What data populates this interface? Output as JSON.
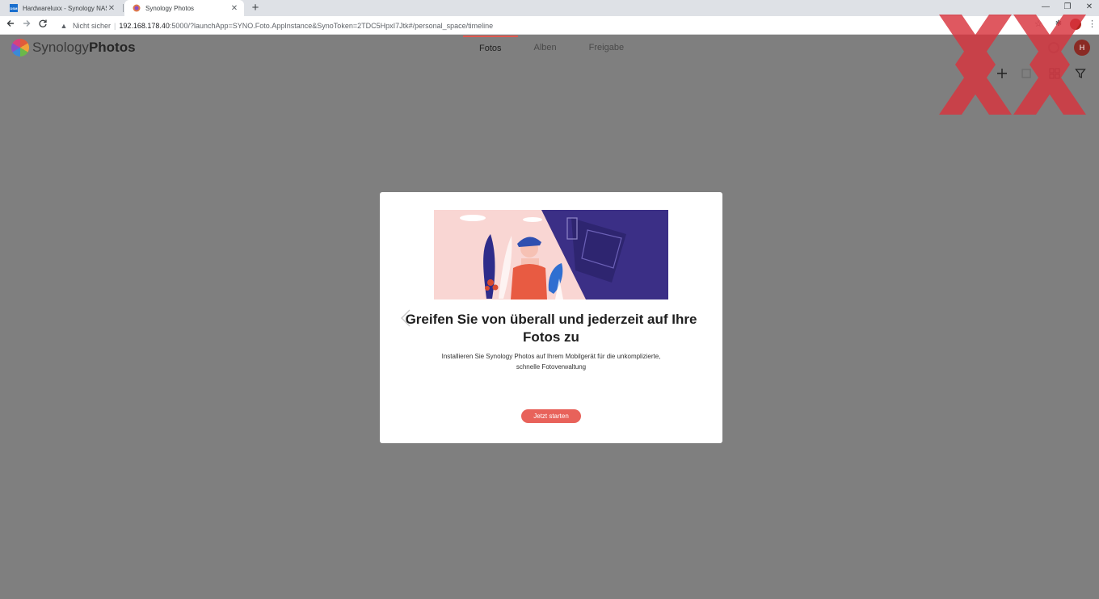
{
  "browser": {
    "tabs": [
      {
        "title": "Hardwareluxx - Synology NAS",
        "icon": "dsm-icon"
      },
      {
        "title": "Synology Photos",
        "icon": "synology-photos-icon"
      }
    ],
    "new_tab": "+",
    "window_controls": {
      "minimize": "—",
      "restore": "❐",
      "close": "✕"
    },
    "security_label": "Nicht sicher",
    "url_host": "192.168.178.40",
    "url_rest": ":5000/?launchApp=SYNO.Foto.AppInstance&SynoToken=2TDC5HpxI7Jtk#/personal_space/timeline"
  },
  "app": {
    "logo_light": "Synology",
    "logo_bold": "Photos",
    "nav": [
      "Fotos",
      "Alben",
      "Freigabe"
    ],
    "active_nav": "Fotos",
    "avatar_initial": "H"
  },
  "modal": {
    "title": "Greifen Sie von überall und jederzeit auf Ihre Fotos zu",
    "description": "Installieren Sie Synology Photos auf Ihrem Mobilgerät für die unkomplizierte, schnelle Fotoverwaltung",
    "cta": "Jetzt starten"
  },
  "colors": {
    "accent": "#e8625a",
    "overlay": "#7f7f7f",
    "watermark": "#d9343e"
  }
}
